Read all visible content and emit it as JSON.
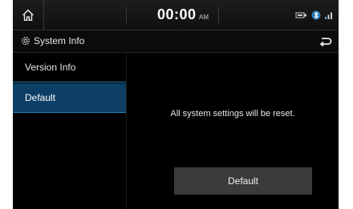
{
  "status_bar": {
    "time": "00:00",
    "ampm": "AM",
    "icons": [
      "home-icon",
      "usb-icon",
      "bluetooth-icon",
      "signal-icon"
    ]
  },
  "title_bar": {
    "title": "System Info",
    "icon": "gear-icon",
    "back_icon": "back-arrow-icon"
  },
  "sidebar": {
    "items": [
      {
        "label": "Version Info",
        "selected": false
      },
      {
        "label": "Default",
        "selected": true
      }
    ]
  },
  "content": {
    "message": "All system settings will be reset.",
    "button_label": "Default"
  },
  "colors": {
    "selected_item": "#0d3f66",
    "accent_line": "#1e7fb0",
    "button_bg": "#3b3b3d"
  }
}
